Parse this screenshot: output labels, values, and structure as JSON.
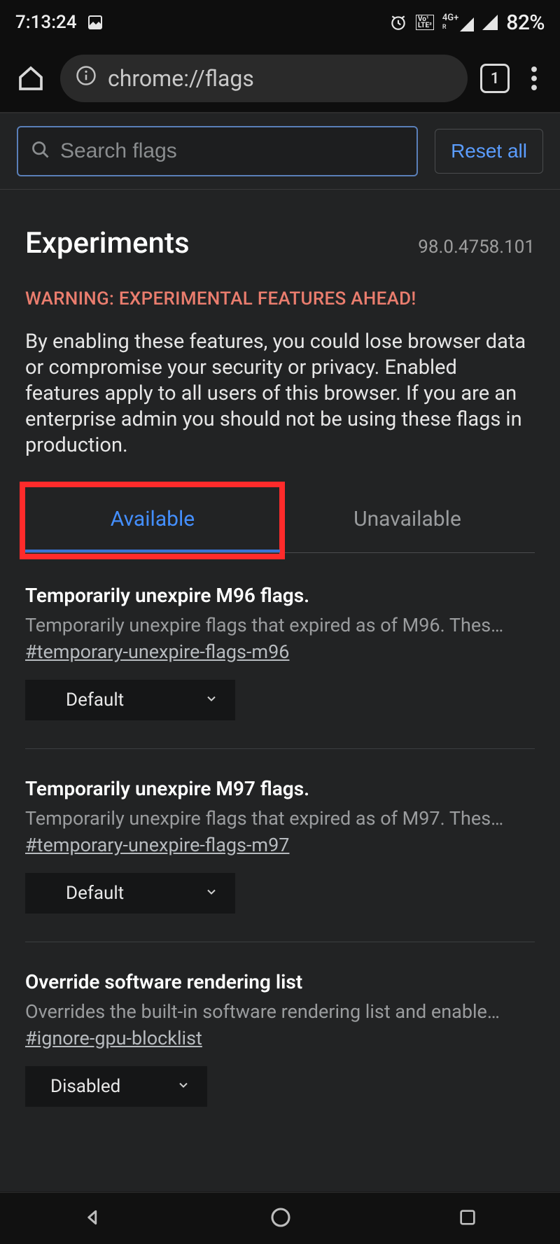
{
  "status": {
    "time": "7:13:24",
    "battery": "82%",
    "lte_label": "LTE",
    "signal_label": "4G+"
  },
  "browser": {
    "url": "chrome://flags",
    "tab_count": "1"
  },
  "page": {
    "search_placeholder": "Search flags",
    "reset_label": "Reset all",
    "title": "Experiments",
    "version": "98.0.4758.101",
    "warning_heading": "WARNING: EXPERIMENTAL FEATURES AHEAD!",
    "warning_body": "By enabling these features, you could lose browser data or compromise your security or privacy. Enabled features apply to all users of this browser. If you are an enterprise admin you should not be using these flags in production.",
    "tabs": {
      "available": "Available",
      "unavailable": "Unavailable"
    },
    "flags": [
      {
        "title": "Temporarily unexpire M96 flags.",
        "desc": "Temporarily unexpire flags that expired as of M96. Thes…",
        "hash": "#temporary-unexpire-flags-m96",
        "value": "Default"
      },
      {
        "title": "Temporarily unexpire M97 flags.",
        "desc": "Temporarily unexpire flags that expired as of M97. Thes…",
        "hash": "#temporary-unexpire-flags-m97",
        "value": "Default"
      },
      {
        "title": "Override software rendering list",
        "desc": "Overrides the built-in software rendering list and enable…",
        "hash": "#ignore-gpu-blocklist",
        "value": "Disabled"
      }
    ]
  }
}
